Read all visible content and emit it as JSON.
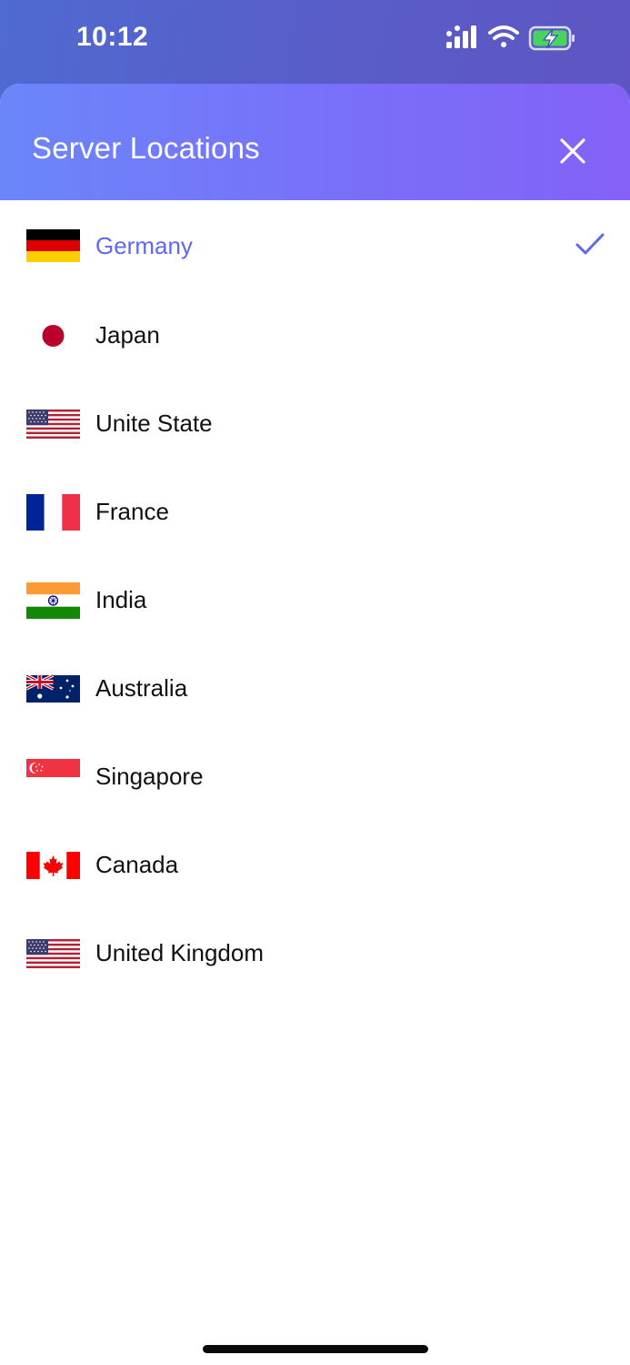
{
  "status_bar": {
    "time": "10:12"
  },
  "sheet": {
    "title": "Server Locations"
  },
  "accent_color": "#5f68ee",
  "countries": [
    {
      "name": "Germany",
      "flag": "germany-flag-icon",
      "selected": true
    },
    {
      "name": "Japan",
      "flag": "japan-flag-icon",
      "selected": false
    },
    {
      "name": "Unite State",
      "flag": "usa-flag-icon",
      "selected": false
    },
    {
      "name": "France",
      "flag": "france-flag-icon",
      "selected": false
    },
    {
      "name": "India",
      "flag": "india-flag-icon",
      "selected": false
    },
    {
      "name": "Australia",
      "flag": "australia-flag-icon",
      "selected": false
    },
    {
      "name": "Singapore",
      "flag": "singapore-flag-icon",
      "selected": false
    },
    {
      "name": "Canada",
      "flag": "canada-flag-icon",
      "selected": false
    },
    {
      "name": "United Kingdom",
      "flag": "usa-flag-icon",
      "selected": false
    }
  ]
}
